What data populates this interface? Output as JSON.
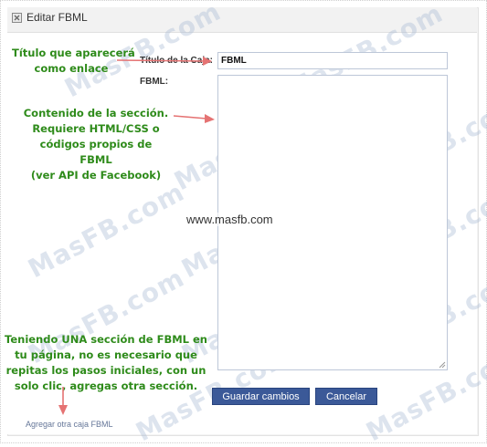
{
  "header": {
    "title": "Editar FBML",
    "icon": "fbml-icon"
  },
  "form": {
    "title_label": "Título de la Caja:",
    "title_value": "FBML",
    "fbml_label": "FBML:",
    "fbml_value": "",
    "save_label": "Guardar cambios",
    "cancel_label": "Cancelar",
    "add_link": "Agregar otra caja FBML"
  },
  "annotations": {
    "note_1": [
      "Título que aparecerá",
      "como enlace"
    ],
    "note_2": [
      "Contenido de la sección.",
      "Requiere HTML/CSS o",
      "códigos propios de",
      "FBML",
      "(ver API de Facebook)"
    ],
    "note_3": [
      "Teniendo UNA sección de FBML en",
      "tu página, no es necesario que",
      "repitas los pasos iniciales, con un",
      "solo clic, agregas otra sección."
    ]
  },
  "overlay": {
    "watermark": "MasFB.com",
    "site": "www.masfb.com"
  },
  "colors": {
    "note_text": "#2e8b1a",
    "arrow": "#e57373",
    "button_bg": "#3b5998",
    "link": "#667799"
  }
}
